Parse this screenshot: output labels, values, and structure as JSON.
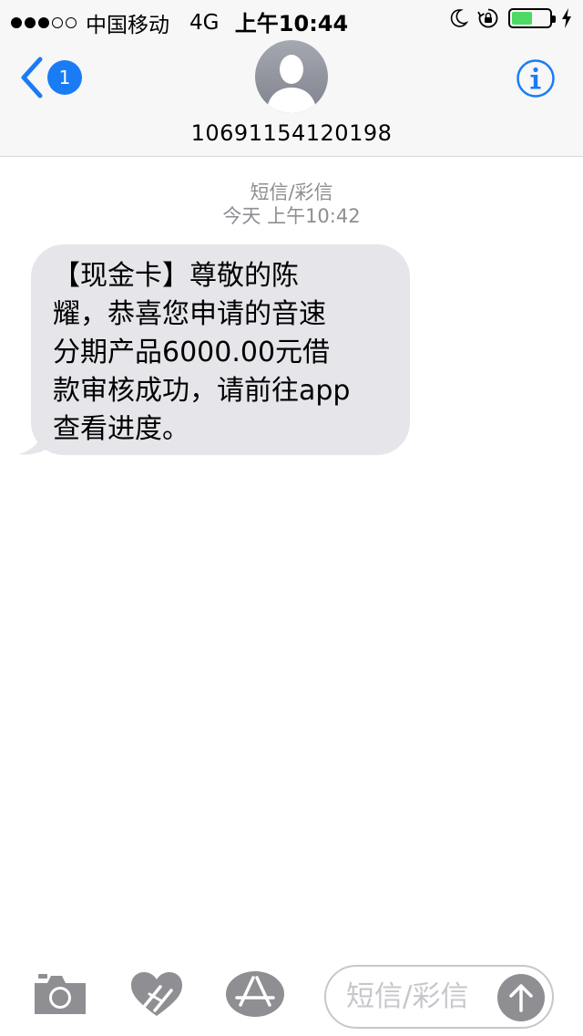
{
  "status_bar": {
    "signal_dots_filled": 3,
    "signal_dots_total": 5,
    "carrier": "中国移动",
    "network": "4G",
    "time": "上午10:44",
    "icons": [
      "moon-icon",
      "rotation-lock-icon",
      "battery-icon",
      "charging-bolt-icon"
    ],
    "battery_level": 0.55
  },
  "header": {
    "back_badge": "1",
    "contact_number": "10691154120198",
    "info_icon": "info-icon",
    "accent_color": "#1a7cf5"
  },
  "conversation": {
    "message_type": "短信/彩信",
    "timestamp": "今天 上午10:42",
    "messages": [
      {
        "lines": [
          "【现金卡】尊敬的陈",
          "耀，恭喜您申请的音速",
          "分期产品6000.00元借",
          "款审核成功，请前往app",
          "查看进度。"
        ]
      }
    ]
  },
  "compose": {
    "placeholder": "短信/彩信",
    "tools": [
      "camera-icon",
      "digital-touch-heart-icon",
      "app-store-icon"
    ],
    "send_icon": "arrow-up-icon"
  }
}
